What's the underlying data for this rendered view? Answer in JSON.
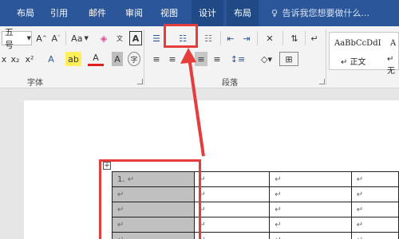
{
  "tabs": [
    {
      "label": "布局"
    },
    {
      "label": "引用"
    },
    {
      "label": "邮件"
    },
    {
      "label": "审阅"
    },
    {
      "label": "视图"
    },
    {
      "label": "设计"
    },
    {
      "label": "布局"
    }
  ],
  "tell_me": "告诉我您想要做什么...",
  "font": {
    "size": "五号",
    "grow": "A",
    "shrink": "A",
    "case": "Aa",
    "group_label": "字体"
  },
  "paragraph": {
    "group_label": "段落"
  },
  "styles": {
    "preview1": "AaBbCcDdI",
    "name1": "正文",
    "preview2": "A",
    "name2": "无"
  },
  "table": {
    "rows": [
      [
        "1.",
        "",
        "",
        ""
      ],
      [
        "",
        "",
        "",
        ""
      ],
      [
        "",
        "",
        "",
        ""
      ],
      [
        "",
        "",
        "",
        ""
      ],
      [
        "",
        "",
        "",
        ""
      ]
    ],
    "cell_mark": "↵"
  },
  "colors": {
    "tab_bg": "#2b579a",
    "highlight": "#e73c3c",
    "selected_cell": "#c0c0c0"
  }
}
